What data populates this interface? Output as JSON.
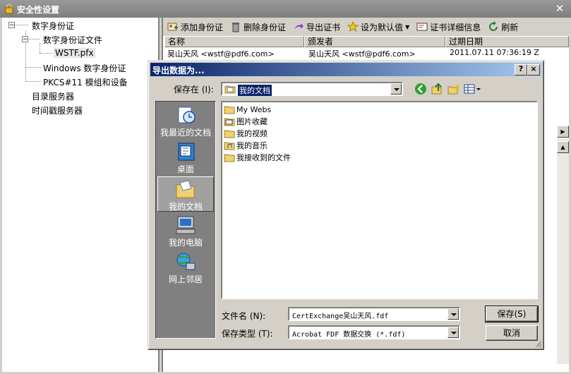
{
  "main_window": {
    "title": "安全性设置",
    "tree": {
      "items": [
        {
          "label": "数字身份证"
        },
        {
          "label": "数字身份证文件"
        },
        {
          "label": "WSTF.pfx"
        },
        {
          "label": "Windows 数字身份证"
        },
        {
          "label": "PKCS#11 模组和设备"
        },
        {
          "label": "目录服务器"
        },
        {
          "label": "时间戳服务器"
        }
      ]
    },
    "toolbar": {
      "add": "添加身份证",
      "delete": "删除身份证",
      "export": "导出证书",
      "set_default": "设为默认值",
      "details": "证书详细信息",
      "refresh": "刷新"
    },
    "list": {
      "columns": [
        "名称",
        "颁发者",
        "过期日期"
      ],
      "rows": [
        {
          "name": "吴山天风 <wstf@pdf6.com>",
          "issuer": "吴山天风 <wstf@pdf6.com>",
          "expires": "2011.07.11 07:36:19 Z"
        }
      ]
    }
  },
  "dialog": {
    "title": "导出数据为...",
    "help_btn": "?",
    "close_btn": "×",
    "save_in_label": "保存在 (I):",
    "save_in_value": "我的文档",
    "places": [
      {
        "label": "我最近的文档",
        "icon": "recent-documents-icon"
      },
      {
        "label": "桌面",
        "icon": "desktop-icon"
      },
      {
        "label": "我的文档",
        "icon": "my-documents-icon"
      },
      {
        "label": "我的电脑",
        "icon": "my-computer-icon"
      },
      {
        "label": "网上邻居",
        "icon": "network-places-icon"
      }
    ],
    "files": [
      {
        "label": "My Webs"
      },
      {
        "label": "图片收藏"
      },
      {
        "label": "我的视频"
      },
      {
        "label": "我的音乐"
      },
      {
        "label": "我接收到的文件"
      }
    ],
    "filename_label": "文件名 (N):",
    "filename_value": "CertExchange吴山天风.fdf",
    "filetype_label": "保存类型 (T):",
    "filetype_value": "Acrobat FDF 数据交换 (*.fdf)",
    "save_btn": "保存(S)",
    "cancel_btn": "取消"
  },
  "colors": {
    "dialog_title_start": "#0a246a",
    "dialog_title_end": "#a6caf0",
    "window_face": "#d4d0c8"
  }
}
